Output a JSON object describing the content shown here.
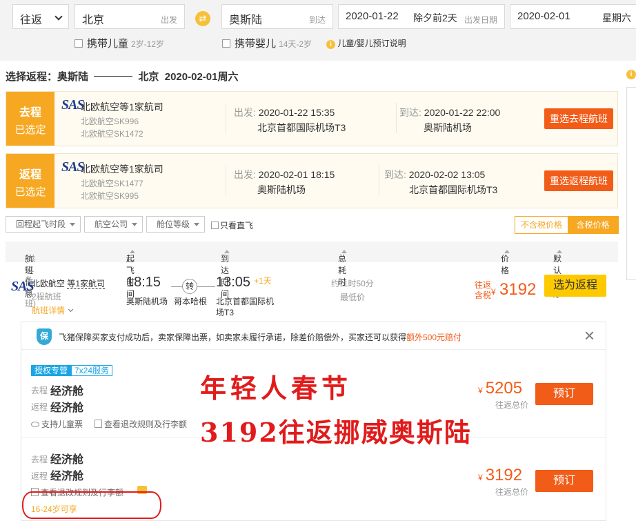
{
  "search": {
    "trip_type": "往返",
    "from_city": "北京",
    "from_label": "出发",
    "to_city": "奥斯陆",
    "to_label": "到达",
    "depart_date": "2020-01-22",
    "depart_note": "除夕前2天",
    "depart_label": "出发日期",
    "return_date": "2020-02-01",
    "return_note": "星期六",
    "child_label": "携带儿童",
    "child_age": "2岁-12岁",
    "infant_label": "携带婴儿",
    "infant_age": "14天-2岁",
    "booking_info": "儿童/婴儿预订说明"
  },
  "route": {
    "prefix": "选择返程：",
    "from": "奥斯陆",
    "to": "北京",
    "date": "2020-02-01周六"
  },
  "legs": [
    {
      "tag1": "去程",
      "tag2": "已选定",
      "logo": "SAS",
      "airline": "北欧航空等1家航司",
      "flight1": "北欧航空SK996",
      "flight2": "北欧航空SK1472",
      "depart_label": "出发:",
      "depart_time": "2020-01-22 15:35",
      "depart_airport": "北京首都国际机场T3",
      "arrive_label": "到达:",
      "arrive_time": "2020-01-22 22:00",
      "arrive_airport": "奥斯陆机场",
      "button": "重选去程航班"
    },
    {
      "tag1": "返程",
      "tag2": "已选定",
      "logo": "SAS",
      "airline": "北欧航空等1家航司",
      "flight1": "北欧航空SK1477",
      "flight2": "北欧航空SK995",
      "depart_label": "出发:",
      "depart_time": "2020-02-01 18:15",
      "depart_airport": "奥斯陆机场",
      "arrive_label": "到达:",
      "arrive_time": "2020-02-02 13:05",
      "arrive_airport": "北京首都国际机场T3",
      "button": "重选返程航班"
    }
  ],
  "filters": {
    "items": [
      "回程起飞时段",
      "航空公司",
      "舱位等级"
    ],
    "direct_only": "只看直飞",
    "tax_excl": "不含税价格",
    "tax_incl": "含税价格"
  },
  "table_header": {
    "flight_info": "航班信息",
    "count": "(共61条航班)",
    "depart_time": "起飞时间",
    "arrive_time": "到达时间",
    "duration": "总耗时",
    "price": "价格",
    "sort": "默认排序"
  },
  "flight": {
    "logo": "SAS",
    "airline": "北欧航空",
    "airline_more": "等1家航司",
    "segments": "2程航班",
    "details": "航班详情",
    "depart_time": "18:15",
    "depart_airport": "奥斯陆机场",
    "transfer": "转",
    "transfer_city": "哥本哈根",
    "arrive_time": "13:05",
    "day_offset": "+1天",
    "arrive_airport_line1": "北京首都国际机",
    "arrive_airport_line2": "场T3",
    "duration": "约11时50分",
    "duration_note": "最低价",
    "price_note1": "往返",
    "price_note2": "含税",
    "currency": "¥",
    "price": "3192",
    "select": "选为返程"
  },
  "panel": {
    "shield": "保",
    "guarantee": "飞猪保障买家支付成功后，卖家保障出票，如卖家未履行承诺，除差价赔偿外，买家还可以获得",
    "guarantee_highlight": "额外500元赔付",
    "close": "×",
    "fares": [
      {
        "badge1": "授权专营",
        "badge2": "7x24服务",
        "out_label": "去程",
        "out_cabin": "经济舱",
        "ret_label": "返程",
        "ret_cabin": "经济舱",
        "child_ticket": "支持儿童票",
        "rules": "查看退改规则及行李额",
        "currency": "¥",
        "price": "5205",
        "price_note": "往返总价",
        "book": "预订"
      },
      {
        "out_label": "去程",
        "out_cabin": "经济舱",
        "ret_label": "返程",
        "ret_cabin": "经济舱",
        "rules": "查看退改规则及行李额",
        "age_limit": "16-24岁可享",
        "currency": "¥",
        "price": "3192",
        "price_note": "往返总价",
        "book": "预订"
      }
    ]
  },
  "overlay": {
    "line1": "年轻人春节",
    "line2": "3192往返挪威奥斯陆"
  }
}
